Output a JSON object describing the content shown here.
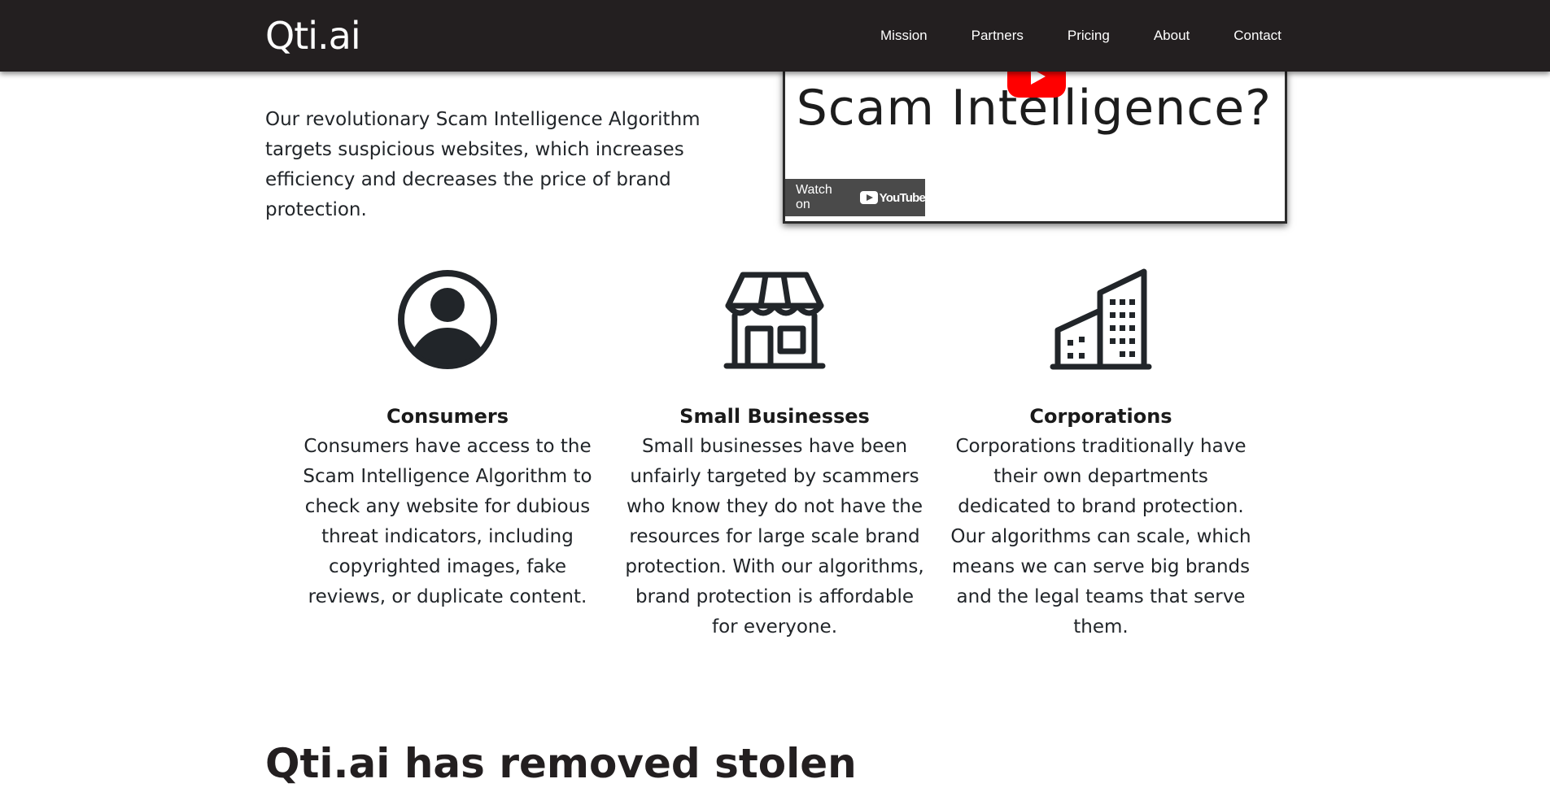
{
  "navbar": {
    "brand": "Qti.ai",
    "links": [
      "Mission",
      "Partners",
      "Pricing",
      "About",
      "Contact"
    ]
  },
  "intro": {
    "text": "Our revolutionary Scam Intelligence Algorithm targets suspicious websites, which increases efficiency and decreases the price of brand protection."
  },
  "video": {
    "title": "Scam Intelligence?",
    "watch_on": "Watch on",
    "youtube_logo_text": "YouTube"
  },
  "features": [
    {
      "icon": "user-circle-icon",
      "title": "Consumers",
      "text": "Consumers have access to the Scam Intelligence Algorithm to check any website for dubious threat indicators, including copyrighted images, fake reviews, or duplicate content."
    },
    {
      "icon": "shop-icon",
      "title": "Small Businesses",
      "text": "Small businesses have been unfairly targeted by scammers who know they do not have the resources for large scale brand protection. With our algorithms, brand protection is affordable for everyone."
    },
    {
      "icon": "buildings-icon",
      "title": "Corporations",
      "text": "Corporations traditionally have their own departments dedicated to brand protection. Our algorithms can scale, which means we can serve big brands and the legal teams that serve them."
    }
  ],
  "bottom_heading": {
    "prefix": "Qti.ai has removed ",
    "bold": "stolen"
  },
  "colors": {
    "navbar_bg": "#231f20",
    "text": "#212529",
    "youtube_red": "#ff0000"
  }
}
